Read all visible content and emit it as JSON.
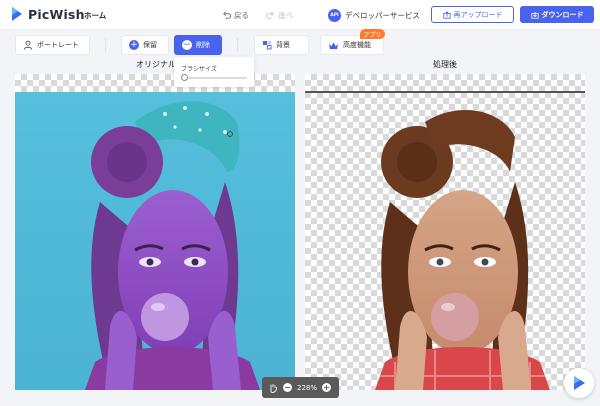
{
  "app": {
    "name": "PicWish"
  },
  "nav": {
    "home": "ホーム",
    "undo": "戻る",
    "redo": "進べ",
    "api": "デベロッパーサービス",
    "api_badge": "API"
  },
  "actions": {
    "reupload": "再アップロード",
    "download": "ダウンロード"
  },
  "toolbar": {
    "portrait": "ポートレート",
    "save": "保留",
    "erase": "削除",
    "background": "背景",
    "advanced": "高度機能",
    "app_tag": "アプリ"
  },
  "brush": {
    "label": "ブラシサイズ",
    "size": 0.05
  },
  "labels": {
    "original": "オリジナル",
    "processed": "処理後"
  },
  "zoom": {
    "level": "228%"
  },
  "colors": {
    "accent": "#4a63ee",
    "tag": "#ff7a2e"
  }
}
